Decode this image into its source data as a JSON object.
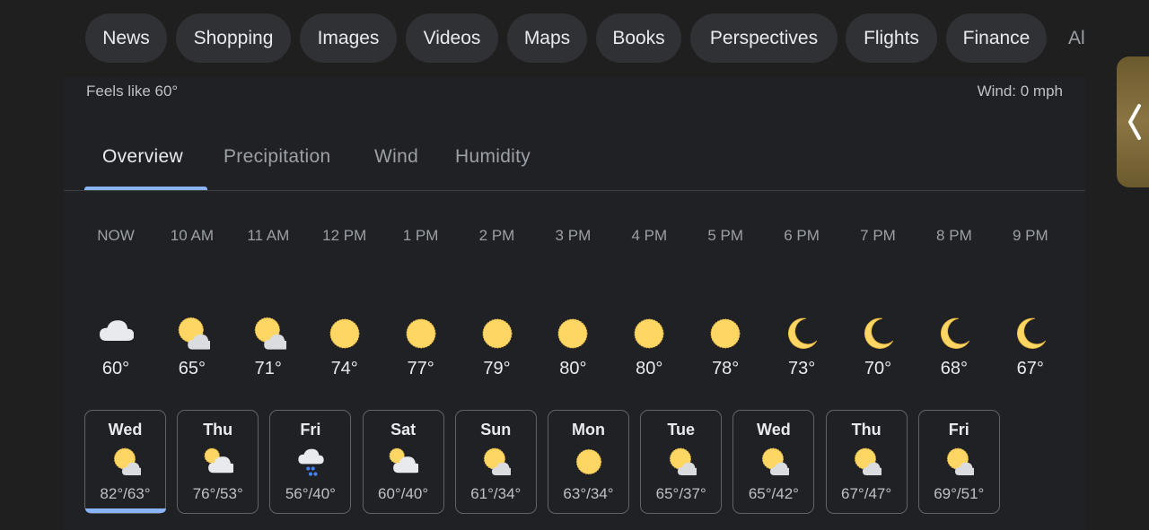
{
  "chips": [
    "News",
    "Shopping",
    "Images",
    "Videos",
    "Maps",
    "Books",
    "Perspectives",
    "Flights",
    "Finance"
  ],
  "chip_overflow": "Al",
  "current": {
    "feels_like": "Feels like 60°",
    "wind": "Wind: 0 mph"
  },
  "tabs": [
    "Overview",
    "Precipitation",
    "Wind",
    "Humidity"
  ],
  "active_tab": "Overview",
  "hourly": [
    {
      "time": "NOW",
      "icon": "cloudy-night-icon",
      "temp": "60°"
    },
    {
      "time": "10 AM",
      "icon": "partly-sunny-icon",
      "temp": "65°"
    },
    {
      "time": "11 AM",
      "icon": "partly-sunny-icon",
      "temp": "71°"
    },
    {
      "time": "12 PM",
      "icon": "sun-icon",
      "temp": "74°"
    },
    {
      "time": "1 PM",
      "icon": "sun-icon",
      "temp": "77°"
    },
    {
      "time": "2 PM",
      "icon": "sun-icon",
      "temp": "79°"
    },
    {
      "time": "3 PM",
      "icon": "sun-icon",
      "temp": "80°"
    },
    {
      "time": "4 PM",
      "icon": "sun-icon",
      "temp": "80°"
    },
    {
      "time": "5 PM",
      "icon": "sun-icon",
      "temp": "78°"
    },
    {
      "time": "6 PM",
      "icon": "moon-icon",
      "temp": "73°"
    },
    {
      "time": "7 PM",
      "icon": "moon-icon",
      "temp": "70°"
    },
    {
      "time": "8 PM",
      "icon": "moon-icon",
      "temp": "68°"
    },
    {
      "time": "9 PM",
      "icon": "moon-icon",
      "temp": "67°"
    }
  ],
  "daily": [
    {
      "day": "Wed",
      "icon": "partly-sunny-icon",
      "range": "82°/63°"
    },
    {
      "day": "Thu",
      "icon": "mostly-cloudy-icon",
      "range": "76°/53°"
    },
    {
      "day": "Fri",
      "icon": "rain-icon",
      "range": "56°/40°"
    },
    {
      "day": "Sat",
      "icon": "mostly-cloudy-icon",
      "range": "60°/40°"
    },
    {
      "day": "Sun",
      "icon": "partly-sunny-icon",
      "range": "61°/34°"
    },
    {
      "day": "Mon",
      "icon": "sun-icon",
      "range": "63°/34°"
    },
    {
      "day": "Tue",
      "icon": "partly-sunny-icon",
      "range": "65°/37°"
    },
    {
      "day": "Wed",
      "icon": "partly-sunny-icon",
      "range": "65°/42°"
    },
    {
      "day": "Thu",
      "icon": "partly-sunny-icon",
      "range": "67°/47°"
    },
    {
      "day": "Fri",
      "icon": "partly-sunny-icon",
      "range": "69°/51°"
    }
  ],
  "colors": {
    "accent": "#8ab4f8",
    "sun": "#fdd663",
    "chip_bg": "#303134",
    "background": "#202124"
  }
}
